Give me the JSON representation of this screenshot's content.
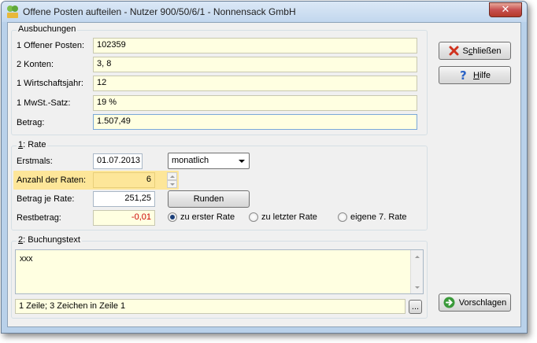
{
  "window": {
    "title": "Offene Posten aufteilen - Nutzer 900/50/6/1 - Nonnensack GmbH",
    "close_symbol": "✕"
  },
  "ausbuchungen": {
    "group_label": "Ausbuchungen",
    "rows": [
      {
        "label": "1 Offener Posten:",
        "value": "102359"
      },
      {
        "label": "2 Konten:",
        "value": "3,  8"
      },
      {
        "label": "1 Wirtschaftsjahr:",
        "value": "12"
      },
      {
        "label": "1 MwSt.-Satz:",
        "value": "19 %"
      },
      {
        "label": "Betrag:",
        "value": "1.507,49"
      }
    ]
  },
  "rate": {
    "group_label_prefix": "1",
    "group_label_suffix": ": Rate",
    "erstmals_label": "Erstmals:",
    "erstmals_value": "01.07.2013",
    "interval_value": "monatlich",
    "anzahl_label": "Anzahl der Raten:",
    "anzahl_value": "6",
    "betrag_label": "Betrag je Rate:",
    "betrag_value": "251,25",
    "runden_label": "Runden",
    "rest_label": "Restbetrag:",
    "rest_value": "-0,01",
    "radios": [
      {
        "label": "zu erster Rate",
        "selected": true
      },
      {
        "label": "zu letzter Rate",
        "selected": false
      },
      {
        "label": "eigene 7. Rate",
        "selected": false
      }
    ]
  },
  "buchungstext": {
    "group_label_prefix": "2",
    "group_label_suffix": ": Buchungstext",
    "text": "xxx",
    "status": "1 Zeile; 3 Zeichen in Zeile 1",
    "ellipsis_label": "..."
  },
  "buttons": {
    "schliessen_prefix": "S",
    "schliessen_accel": "c",
    "schliessen_suffix": "hließen",
    "hilfe_accel": "H",
    "hilfe_suffix": "ilfe",
    "vorschlagen_label": "Vorschlagen"
  },
  "colors": {
    "field_bg": "#ffffe1",
    "highlight": "#fde699",
    "negative": "#cc0000"
  }
}
